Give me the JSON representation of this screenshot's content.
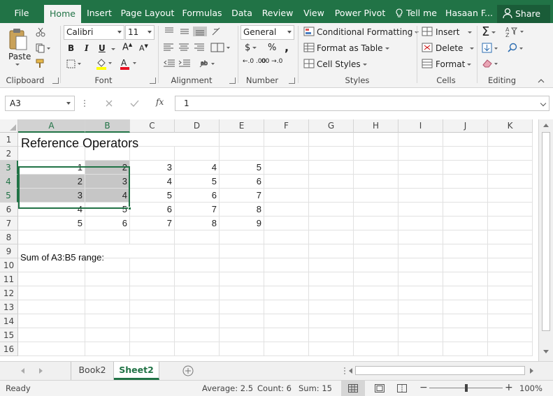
{
  "ribbon_tabs": [
    {
      "label": "File",
      "active": false
    },
    {
      "label": "Home",
      "active": true
    },
    {
      "label": "Insert",
      "active": false
    },
    {
      "label": "Page Layout",
      "active": false
    },
    {
      "label": "Formulas",
      "active": false
    },
    {
      "label": "Data",
      "active": false
    },
    {
      "label": "Review",
      "active": false
    },
    {
      "label": "View",
      "active": false
    },
    {
      "label": "Power Pivot",
      "active": false
    }
  ],
  "tell_me": "Tell me",
  "user": "Hasaan F...",
  "share": "Share",
  "clipboard": {
    "label": "Clipboard",
    "paste": "Paste"
  },
  "font": {
    "label": "Font",
    "name": "Calibri",
    "size": "11",
    "bold": "B",
    "italic": "I",
    "underline": "U",
    "highlight_color": "#ffff00",
    "font_color": "#e81123"
  },
  "alignment": {
    "label": "Alignment"
  },
  "number": {
    "label": "Number",
    "format": "General",
    "currency": "$",
    "percent": "%",
    "comma": ",",
    "inc_decimal": "←.0 .00",
    "dec_decimal": ".00 →.0"
  },
  "styles": {
    "label": "Styles",
    "conditional": "Conditional Formatting",
    "format_table": "Format as Table",
    "cell_styles": "Cell Styles"
  },
  "cells": {
    "label": "Cells",
    "insert": "Insert",
    "delete": "Delete",
    "format": "Format"
  },
  "editing": {
    "label": "Editing",
    "sum": "Σ"
  },
  "formula_bar": {
    "name_box": "A3",
    "fx": "fx",
    "value": "1"
  },
  "columns": [
    "A",
    "B",
    "C",
    "D",
    "E",
    "F",
    "G",
    "H",
    "I",
    "J",
    "K"
  ],
  "rows": [
    "1",
    "2",
    "3",
    "4",
    "5",
    "6",
    "7",
    "8",
    "9",
    "10",
    "11",
    "12",
    "13",
    "14",
    "15",
    "16"
  ],
  "title": "Reference Operators",
  "table": [
    [
      "1",
      "2",
      "3",
      "4",
      "5"
    ],
    [
      "2",
      "3",
      "4",
      "5",
      "6"
    ],
    [
      "3",
      "4",
      "5",
      "6",
      "7"
    ],
    [
      "4",
      "5",
      "6",
      "7",
      "8"
    ],
    [
      "5",
      "6",
      "7",
      "8",
      "9"
    ]
  ],
  "sum_label": "Sum of A3:B5 range:",
  "sheets": [
    {
      "label": "Book2",
      "active": false
    },
    {
      "label": "Sheet2",
      "active": true
    }
  ],
  "status": {
    "ready": "Ready",
    "average": "Average: 2.5",
    "count": "Count: 6",
    "sum": "Sum: 15",
    "zoom": "100%",
    "zoom_level_percent": 100
  },
  "accent_color": "#217346"
}
